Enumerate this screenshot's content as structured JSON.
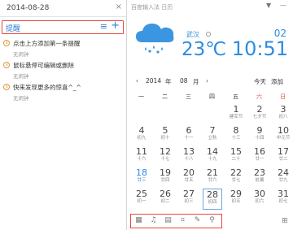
{
  "left": {
    "date": "2014-08-28",
    "close": "×",
    "reminder_title": "提醒",
    "list_icon": "≡",
    "add_icon": "+",
    "items": [
      {
        "text": "点击上方添加第一条提醒",
        "sub": "无闹钟"
      },
      {
        "text": "鼠标悬停可编辑或删除",
        "sub": "无闹钟"
      },
      {
        "text": "快来发现更多的惊喜^_^",
        "sub": "无闹钟"
      }
    ]
  },
  "right": {
    "app_title": "百度输入法 日历",
    "weather": {
      "city": "武汉",
      "temp": "23℃",
      "date": "02",
      "time": "10:51"
    },
    "nav": {
      "prev": "‹",
      "year": "2014",
      "year_unit": "年",
      "month": "08",
      "month_unit": "月",
      "next": "›",
      "today": "今天",
      "add": "添加"
    },
    "weekdays": [
      "一",
      "二",
      "三",
      "四",
      "五",
      "六",
      "日"
    ],
    "weeks": [
      [
        {
          "d": "",
          "l": ""
        },
        {
          "d": "",
          "l": ""
        },
        {
          "d": "",
          "l": ""
        },
        {
          "d": "",
          "l": ""
        },
        {
          "d": "1",
          "l": "建军节"
        },
        {
          "d": "2",
          "l": "七夕节"
        },
        {
          "d": "3",
          "l": "初八"
        }
      ],
      [
        {
          "d": "4",
          "l": "初九"
        },
        {
          "d": "5",
          "l": "初十"
        },
        {
          "d": "6",
          "l": "十一"
        },
        {
          "d": "7",
          "l": "立秋"
        },
        {
          "d": "8",
          "l": "十三"
        },
        {
          "d": "9",
          "l": "十四"
        },
        {
          "d": "10",
          "l": "中元节"
        }
      ],
      [
        {
          "d": "11",
          "l": "十六"
        },
        {
          "d": "12",
          "l": "十七"
        },
        {
          "d": "13",
          "l": "十八"
        },
        {
          "d": "14",
          "l": "十九"
        },
        {
          "d": "15",
          "l": "二十"
        },
        {
          "d": "16",
          "l": "廿一"
        },
        {
          "d": "17",
          "l": "廿二"
        }
      ],
      [
        {
          "d": "18",
          "l": "廿三"
        },
        {
          "d": "19",
          "l": "廿四"
        },
        {
          "d": "20",
          "l": "廿五"
        },
        {
          "d": "21",
          "l": "廿六"
        },
        {
          "d": "22",
          "l": "廿七"
        },
        {
          "d": "23",
          "l": "处暑"
        },
        {
          "d": "24",
          "l": "廿九"
        }
      ],
      [
        {
          "d": "25",
          "l": "初一"
        },
        {
          "d": "26",
          "l": "初二"
        },
        {
          "d": "27",
          "l": "初三"
        },
        {
          "d": "28",
          "l": "初四"
        },
        {
          "d": "29",
          "l": "初五"
        },
        {
          "d": "30",
          "l": "初六"
        },
        {
          "d": "31",
          "l": "初七"
        }
      ]
    ]
  },
  "colors": {
    "accent": "#2d8ce0",
    "highlight_border": "#e8473d",
    "weekend_red": "#e8473d"
  }
}
